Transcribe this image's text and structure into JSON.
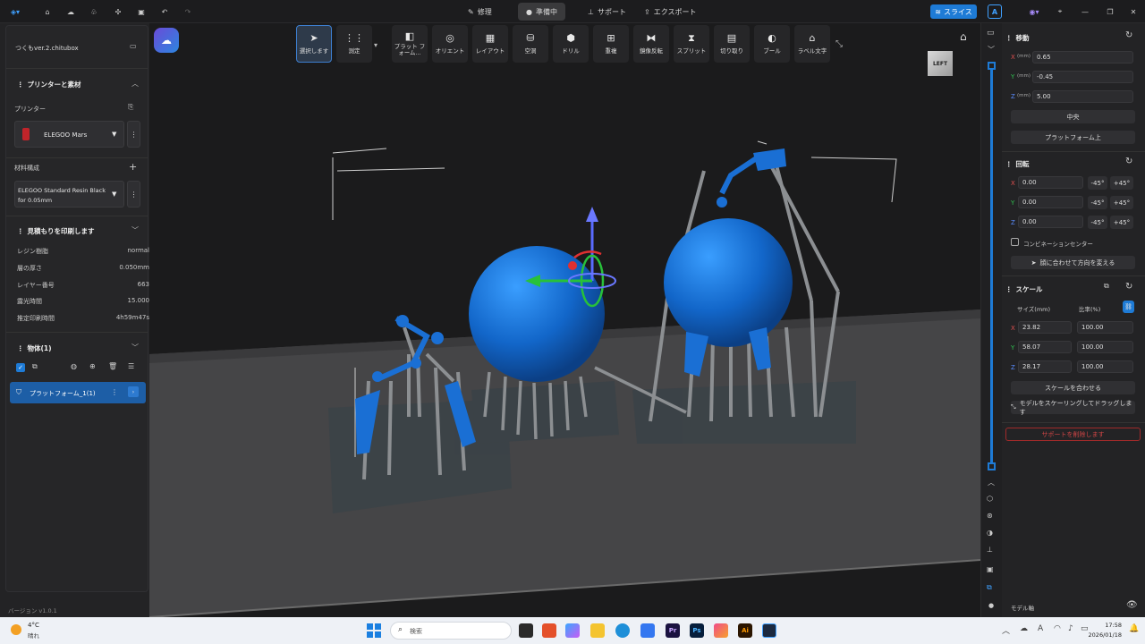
{
  "titlebar": {
    "tabs": [
      {
        "label": "修理"
      },
      {
        "label": "準備中"
      },
      {
        "label": "サポート"
      },
      {
        "label": "エクスポート"
      }
    ],
    "slice_label": "スライス",
    "account": "A"
  },
  "left": {
    "project_name": "つくもver.2.chitubox",
    "printer_section": "プリンターと素材",
    "printer_label": "プリンター",
    "printer_value": "ELEGOO Mars",
    "material_label": "材料構成",
    "material_value": "ELEGOO Standard Resin Black for 0.05mm",
    "estimate_section": "見積もりを印刷します",
    "estimate": [
      {
        "k": "レジン樹脂",
        "v": "normal"
      },
      {
        "k": "層の厚さ",
        "v": "0.050mm"
      },
      {
        "k": "レイヤー番号",
        "v": "663"
      },
      {
        "k": "露光時間",
        "v": "15.000"
      },
      {
        "k": "推定印刷時間",
        "v": "4h59m47s"
      }
    ],
    "objects_section": "物体(1)",
    "object_item": "プラットフォーム_1(1)",
    "version": "バージョン v1.0.1"
  },
  "toolbar": {
    "tools": [
      {
        "label": "選択します",
        "icon": "cursor-icon"
      },
      {
        "label": "測定",
        "icon": "measure-icon"
      },
      {
        "label": "プラット フォーム...",
        "icon": "platform-icon"
      },
      {
        "label": "オリエント",
        "icon": "orient-icon"
      },
      {
        "label": "レイアウト",
        "icon": "layout-icon"
      },
      {
        "label": "空洞",
        "icon": "hollow-icon"
      },
      {
        "label": "ドリル",
        "icon": "drill-icon"
      },
      {
        "label": "重複",
        "icon": "duplicate-icon"
      },
      {
        "label": "鏡像反転",
        "icon": "mirror-icon"
      },
      {
        "label": "スプリット",
        "icon": "split-icon"
      },
      {
        "label": "切り取り",
        "icon": "cut-icon"
      },
      {
        "label": "ブール",
        "icon": "boolean-icon"
      },
      {
        "label": "ラベル文字",
        "icon": "label-icon"
      }
    ]
  },
  "viewcube": "LEFT",
  "right": {
    "move_title": "移動",
    "move": {
      "x": "0.65",
      "y": "-0.45",
      "z": "5.00",
      "unit": "(mm)"
    },
    "center_btn": "中央",
    "on_platform_btn": "プラットフォーム上",
    "rotate_title": "回転",
    "rotate": {
      "x": "0.00",
      "y": "0.00",
      "z": "0.00"
    },
    "minus45": "-45°",
    "plus45": "+45°",
    "combination_center": "コンビネーションセンター",
    "face_align_btn": "顔に合わせて方向を変える",
    "scale_title": "スケール",
    "size_label": "サイズ(mm)",
    "ratio_label": "比率(%)",
    "scale": {
      "x": "23.82",
      "y": "58.07",
      "z": "28.17",
      "rx": "100.00",
      "ry": "100.00",
      "rz": "100.00"
    },
    "fit_scale_btn": "スケールを合わせる",
    "drag_scale_btn": "モデルをスケーリングしてドラッグします",
    "delete_support_btn": "サポートを削除します",
    "model_axis": "モデル軸"
  },
  "taskbar": {
    "temp": "4°C",
    "weather": "晴れ",
    "search": "検索",
    "time": "17:58",
    "date": "2026/01/18"
  }
}
